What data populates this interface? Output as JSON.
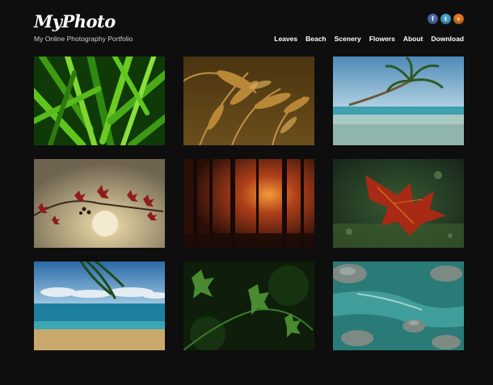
{
  "brand": {
    "name": "MyPhoto",
    "tagline": "My Online Photography Portfolio"
  },
  "social": [
    {
      "name": "facebook-icon",
      "glyph": "f"
    },
    {
      "name": "twitter-icon",
      "glyph": "t"
    },
    {
      "name": "rss-icon",
      "glyph": "◗"
    }
  ],
  "nav": [
    "Leaves",
    "Beach",
    "Scenery",
    "Flowers",
    "About",
    "Download"
  ],
  "gallery": [
    {
      "subject": "green-leaves"
    },
    {
      "subject": "wheat-field"
    },
    {
      "subject": "palm-beach"
    },
    {
      "subject": "branch-sunset"
    },
    {
      "subject": "forest-sunrise"
    },
    {
      "subject": "red-leaf"
    },
    {
      "subject": "beach-palm-shore"
    },
    {
      "subject": "green-plant"
    },
    {
      "subject": "river-rocks"
    }
  ],
  "colors": {
    "background": "#0e0e0e",
    "text": "#ffffff"
  }
}
